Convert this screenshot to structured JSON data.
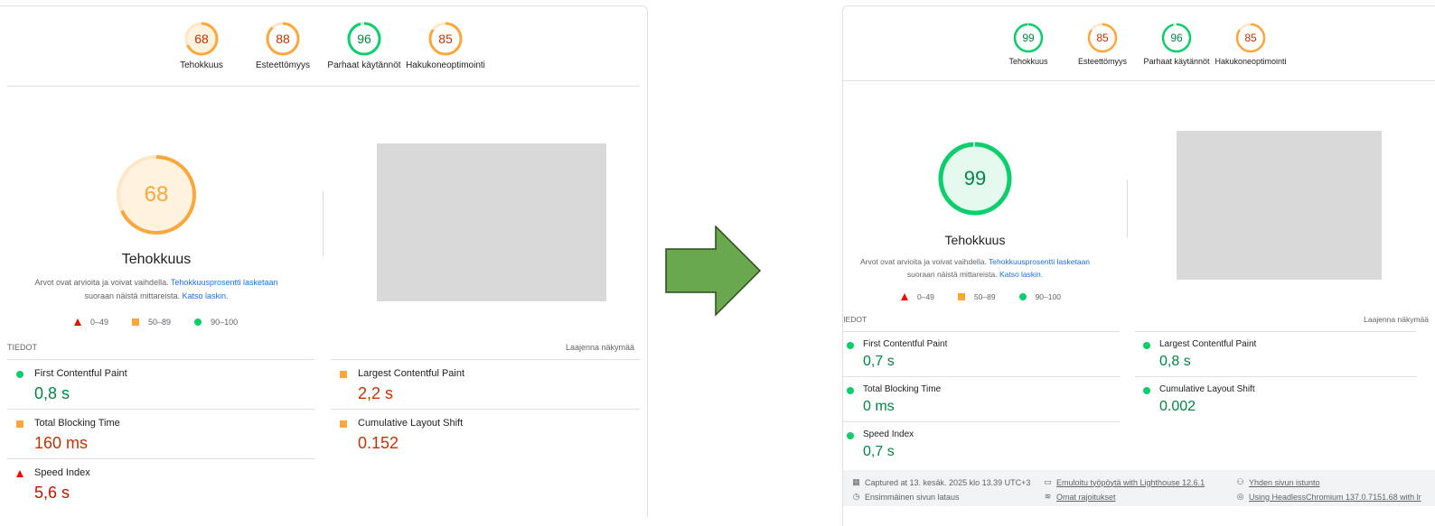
{
  "colors": {
    "pass": "#0cce6b",
    "average": "#fba73c",
    "fail": "#eb0f00",
    "screenshot": "#d9d9d9",
    "arrow": "#6aa84f"
  },
  "before": {
    "gauges": [
      {
        "score": "68",
        "label": "Tehokkuus",
        "level": "average"
      },
      {
        "score": "88",
        "label": "Esteettömyys",
        "level": "average"
      },
      {
        "score": "96",
        "label": "Parhaat käytännöt",
        "level": "pass"
      },
      {
        "score": "85",
        "label": "Hakukoneoptimointi",
        "level": "average"
      }
    ],
    "main_score": "68",
    "category_title": "Tehokkuus",
    "desc_text": "Arvot ovat arvioita ja voivat vaihdella.",
    "desc_link1": "Tehokkuusprosentti lasketaan",
    "desc_text2": "suoraan näistä mittareista.",
    "desc_link2": "Katso laskin.",
    "legend": [
      "0–49",
      "50–89",
      "90–100"
    ],
    "section_title": "TIEDOT",
    "expand_label": "Laajenna näkymää",
    "metrics": [
      {
        "name": "First Contentful Paint",
        "value": "0,8 s",
        "level": "pass"
      },
      {
        "name": "Largest Contentful Paint",
        "value": "2,2 s",
        "level": "average"
      },
      {
        "name": "Total Blocking Time",
        "value": "160 ms",
        "level": "average"
      },
      {
        "name": "Cumulative Layout Shift",
        "value": "0.152",
        "level": "average"
      },
      {
        "name": "Speed Index",
        "value": "5,6 s",
        "level": "fail"
      }
    ]
  },
  "after": {
    "gauges": [
      {
        "score": "99",
        "label": "Tehokkuus",
        "level": "pass"
      },
      {
        "score": "85",
        "label": "Esteettömyys",
        "level": "average"
      },
      {
        "score": "96",
        "label": "Parhaat käytännöt",
        "level": "pass"
      },
      {
        "score": "85",
        "label": "Hakukoneoptimointi",
        "level": "average"
      }
    ],
    "main_score": "99",
    "category_title": "Tehokkuus",
    "desc_text": "Arvot ovat arvioita ja voivat vaihdella.",
    "desc_link1": "Tehokkuusprosentti lasketaan",
    "desc_text2": "suoraan näistä mittareista.",
    "desc_link2": "Katso laskin.",
    "legend": [
      "0–49",
      "50–89",
      "90–100"
    ],
    "section_title": "TIEDOT",
    "expand_label": "Laajenna näkymää",
    "metrics": [
      {
        "name": "First Contentful Paint",
        "value": "0,7 s",
        "level": "pass"
      },
      {
        "name": "Largest Contentful Paint",
        "value": "0,8 s",
        "level": "pass"
      },
      {
        "name": "Total Blocking Time",
        "value": "0 ms",
        "level": "pass"
      },
      {
        "name": "Cumulative Layout Shift",
        "value": "0.002",
        "level": "pass"
      },
      {
        "name": "Speed Index",
        "value": "0,7 s",
        "level": "pass"
      }
    ],
    "footer": {
      "captured": "Captured at 13. kesäk. 2025 klo 13.39 UTC+3",
      "emulated": "Emuloitu työpöytä with Lighthouse 12.6.1",
      "session": "Yhden sivun istunto",
      "first_load": "Ensimmäinen sivun lataus",
      "throttling": "Omat rajoitukset",
      "browser": "Using HeadlessChromium 137.0.7151.68 with lr"
    }
  }
}
